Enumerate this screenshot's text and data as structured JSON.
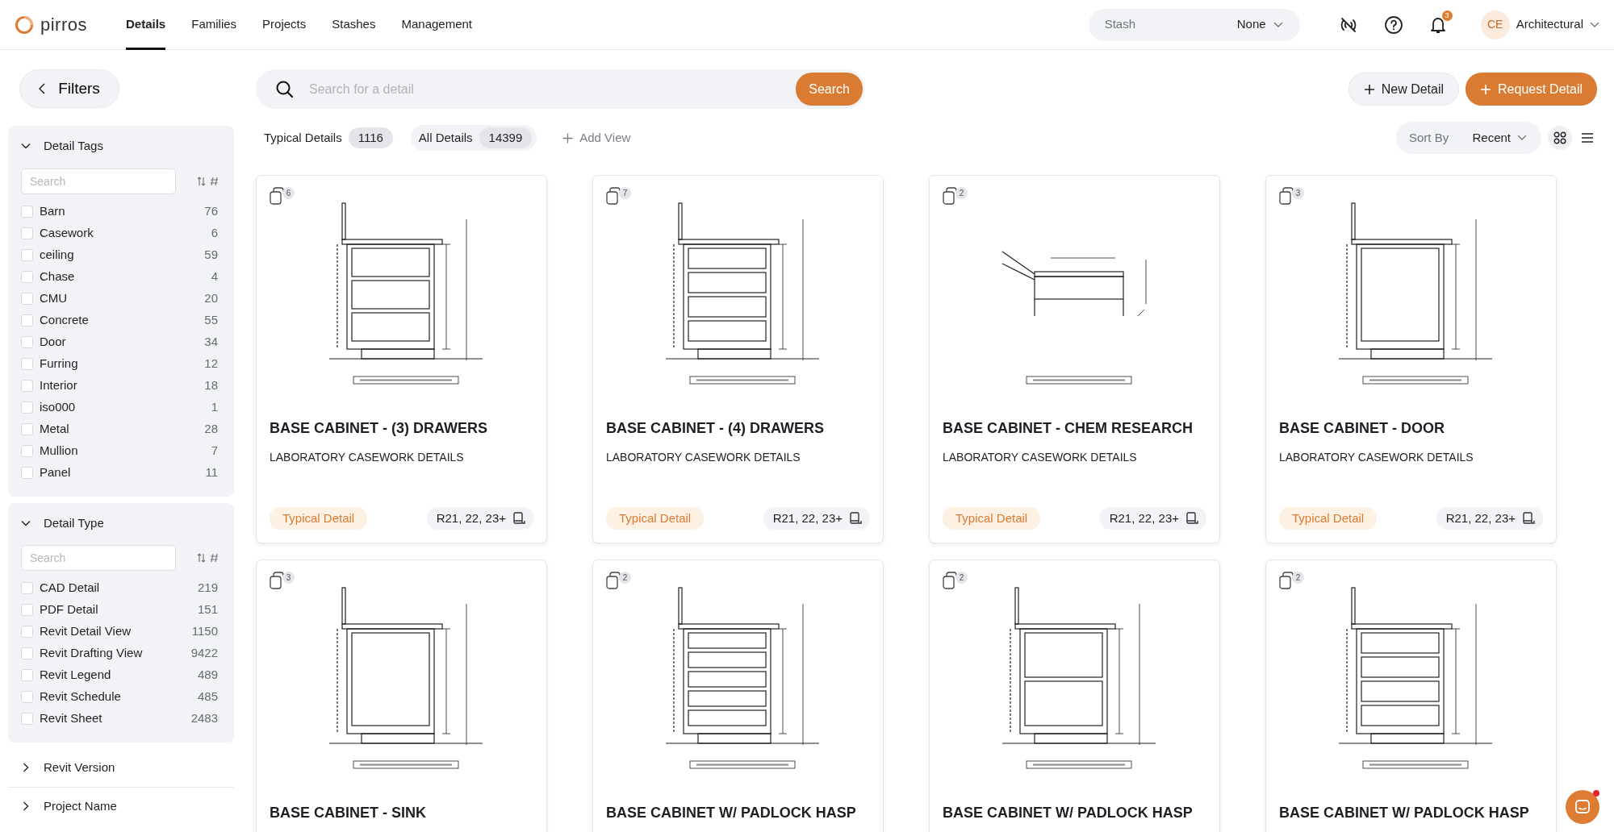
{
  "nav": {
    "logo": "pirros",
    "tabs": [
      {
        "label": "Details",
        "selected": true
      },
      {
        "label": "Families",
        "selected": false
      },
      {
        "label": "Projects",
        "selected": false
      },
      {
        "label": "Stashes",
        "selected": false
      },
      {
        "label": "Management",
        "selected": false
      }
    ],
    "stash": {
      "label": "Stash",
      "value": "None"
    },
    "notifications": "3",
    "user": {
      "initials": "CE",
      "name": "Architectural"
    }
  },
  "sidebar": {
    "filters_button": "Filters",
    "sections": [
      {
        "title": "Detail Tags",
        "expanded": true,
        "placeholder": "Search",
        "items": [
          {
            "label": "Barn",
            "count": "76",
            "checked": false
          },
          {
            "label": "Casework",
            "count": "6",
            "checked": false
          },
          {
            "label": "ceiling",
            "count": "59",
            "checked": false
          },
          {
            "label": "Chase",
            "count": "4",
            "checked": false
          },
          {
            "label": "CMU",
            "count": "20",
            "checked": false
          },
          {
            "label": "Concrete",
            "count": "55",
            "checked": false
          },
          {
            "label": "Door",
            "count": "34",
            "checked": false
          },
          {
            "label": "Furring",
            "count": "12",
            "checked": false
          },
          {
            "label": "Interior",
            "count": "18",
            "checked": false
          },
          {
            "label": "iso000",
            "count": "1",
            "checked": false
          },
          {
            "label": "Metal",
            "count": "28",
            "checked": false
          },
          {
            "label": "Mullion",
            "count": "7",
            "checked": false
          },
          {
            "label": "Panel",
            "count": "11",
            "checked": false
          }
        ]
      },
      {
        "title": "Detail Type",
        "expanded": true,
        "placeholder": "Search",
        "items": [
          {
            "label": "CAD Detail",
            "count": "219",
            "checked": false
          },
          {
            "label": "PDF Detail",
            "count": "151",
            "checked": false
          },
          {
            "label": "Revit Detail View",
            "count": "1150",
            "checked": false
          },
          {
            "label": "Revit Drafting View",
            "count": "9422",
            "checked": false
          },
          {
            "label": "Revit Legend",
            "count": "489",
            "checked": false
          },
          {
            "label": "Revit Schedule",
            "count": "485",
            "checked": false
          },
          {
            "label": "Revit Sheet",
            "count": "2483",
            "checked": false
          }
        ]
      },
      {
        "title": "Revit Version",
        "expanded": false
      },
      {
        "title": "Project Name",
        "expanded": false
      }
    ]
  },
  "search": {
    "placeholder": "Search for a detail",
    "button": "Search"
  },
  "actions": [
    "New Detail",
    "Request Detail"
  ],
  "views": [
    {
      "label": "Typical Details",
      "count": "1116",
      "selected": false
    },
    {
      "label": "All Details",
      "count": "14399",
      "selected": true
    }
  ],
  "add_view": "Add View",
  "sort": {
    "label": "Sort By",
    "value": "Recent"
  },
  "layout_modes": [
    {
      "kind": "grid",
      "selected": true
    },
    {
      "kind": "list",
      "selected": false
    }
  ],
  "cards": [
    {
      "count": "6",
      "title": "BASE CABINET - (3) DRAWERS",
      "subtitle": "LABORATORY CASEWORK DETAILS",
      "tag": "Typical Detail",
      "versions": "R21, 22, 23+"
    },
    {
      "count": "7",
      "title": "BASE CABINET - (4) DRAWERS",
      "subtitle": "LABORATORY CASEWORK DETAILS",
      "tag": "Typical Detail",
      "versions": "R21, 22, 23+"
    },
    {
      "count": "2",
      "title": "BASE CABINET - CHEM RESEARCH",
      "subtitle": "LABORATORY CASEWORK DETAILS",
      "tag": "Typical Detail",
      "versions": "R21, 22, 23+"
    },
    {
      "count": "3",
      "title": "BASE CABINET - DOOR",
      "subtitle": "LABORATORY CASEWORK DETAILS",
      "tag": "Typical Detail",
      "versions": "R21, 22, 23+"
    },
    {
      "count": "3",
      "title": "BASE CABINET - SINK"
    },
    {
      "count": "2",
      "title": "BASE CABINET W/ PADLOCK HASP"
    },
    {
      "count": "2",
      "title": "BASE CABINET W/ PADLOCK HASP"
    },
    {
      "count": "2",
      "title": "BASE CABINET W/ PADLOCK HASP"
    }
  ]
}
